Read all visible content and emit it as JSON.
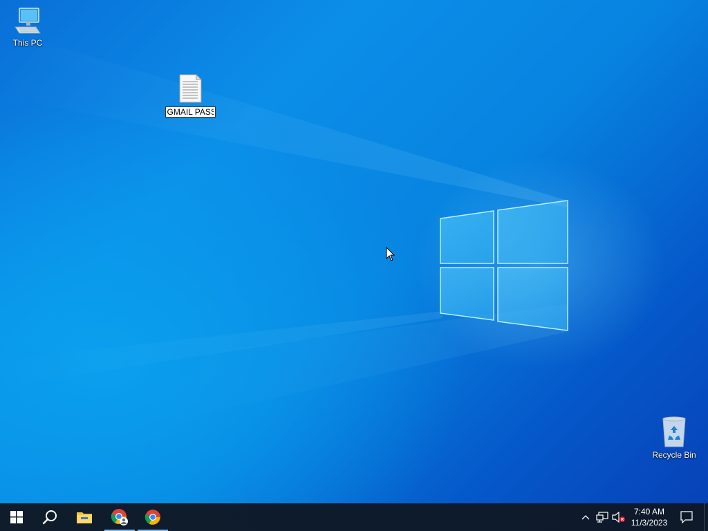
{
  "desktop": {
    "icons": {
      "this_pc": {
        "label": "This PC",
        "icon": "computer-icon"
      },
      "recycle_bin": {
        "label": "Recycle Bin",
        "icon": "recycle-bin-icon"
      },
      "text_file": {
        "rename_value": "GMAIL PASS",
        "icon": "text-document-icon"
      }
    },
    "wallpaper": {
      "accent": "#0a84e0",
      "logo": "windows-logo"
    }
  },
  "taskbar": {
    "start": {
      "icon": "windows-start-icon"
    },
    "search": {
      "icon": "search-icon"
    },
    "pinned": [
      {
        "name": "File Explorer",
        "icon": "folder-icon",
        "active": false
      },
      {
        "name": "Chrome (profile)",
        "icon": "chrome-profile-icon",
        "active": true
      },
      {
        "name": "Google Chrome",
        "icon": "chrome-icon",
        "active": true
      }
    ],
    "tray": {
      "chevron_icon": "chevron-up-icon",
      "network_icon": "network-icon",
      "volume_icon": "volume-muted-icon",
      "time": "7:40 AM",
      "date": "11/3/2023",
      "notifications_icon": "action-center-icon"
    }
  }
}
